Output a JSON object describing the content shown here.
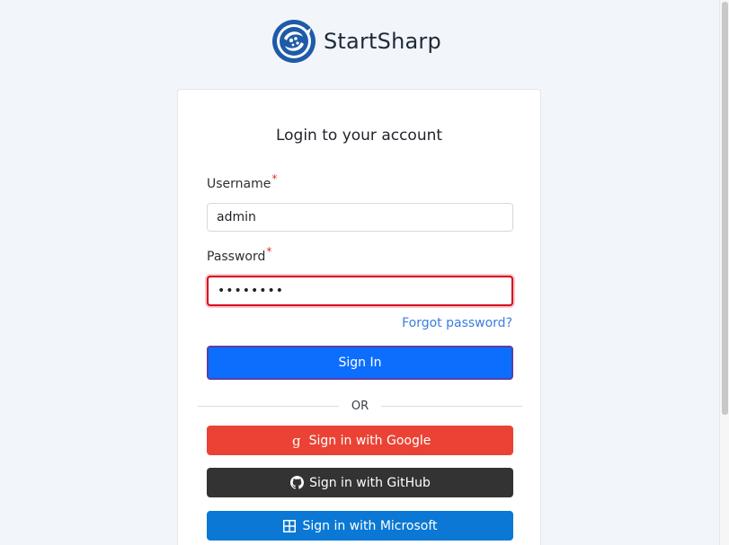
{
  "brand": {
    "name": "StartSharp",
    "logo_icon": "startsharp-logo-icon",
    "logo_color": "#1e5ba8"
  },
  "login": {
    "title": "Login to your account",
    "username_label": "Username",
    "username_required": "*",
    "username_value": "admin",
    "password_label": "Password",
    "password_required": "*",
    "password_value": "••••••••",
    "forgot_password": "Forgot password?",
    "sign_in": "Sign In",
    "divider": "OR"
  },
  "social": {
    "google": {
      "label": "Sign in with Google",
      "icon": "google-icon",
      "color": "#ea4335"
    },
    "github": {
      "label": "Sign in with GitHub",
      "icon": "github-icon",
      "color": "#333333"
    },
    "microsoft": {
      "label": "Sign in with Microsoft",
      "icon": "microsoft-icon",
      "color": "#0a78d4"
    }
  },
  "colors": {
    "background": "#f2f5f9",
    "primary": "#0d6efd",
    "error_border": "#d6001c",
    "link": "#3b7ddd"
  }
}
